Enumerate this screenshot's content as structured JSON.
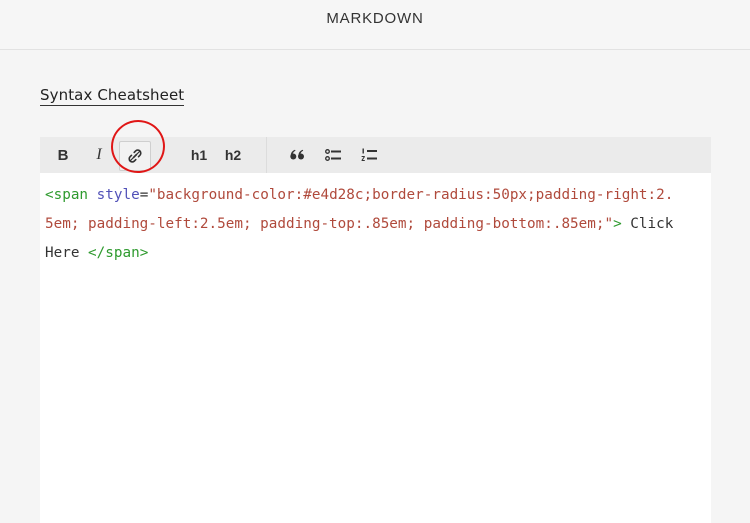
{
  "header": {
    "title": "MARKDOWN"
  },
  "cheatsheet_link": "Syntax Cheatsheet",
  "toolbar": {
    "bold_label": "B",
    "italic_label": "I",
    "h1_label": "h1",
    "h2_label": "h2",
    "link_icon": "link-icon",
    "quote_icon": "quote-icon",
    "unordered_list_icon": "bullet-list-icon",
    "ordered_list_icon": "numbered-list-icon"
  },
  "annotation": {
    "color": "#e01616"
  },
  "editor": {
    "code": {
      "open_tag": "<span",
      "attr_name": " style",
      "equals": "=",
      "attr_value": "\"background-color:#e4d28c;border-radius:50px;padding-right:2.5em; padding-left:2.5em; padding-top:.85em; padding-bottom:.85em;\"",
      "tag_close": ">",
      "inner_text": " Click Here ",
      "close_tag": "</span>"
    }
  },
  "colors": {
    "tag": "#2e9a2e",
    "attribute": "#5151b8",
    "string": "#b04a3c",
    "toolbar_bg": "#ebebeb",
    "page_bg": "#f5f5f5"
  }
}
